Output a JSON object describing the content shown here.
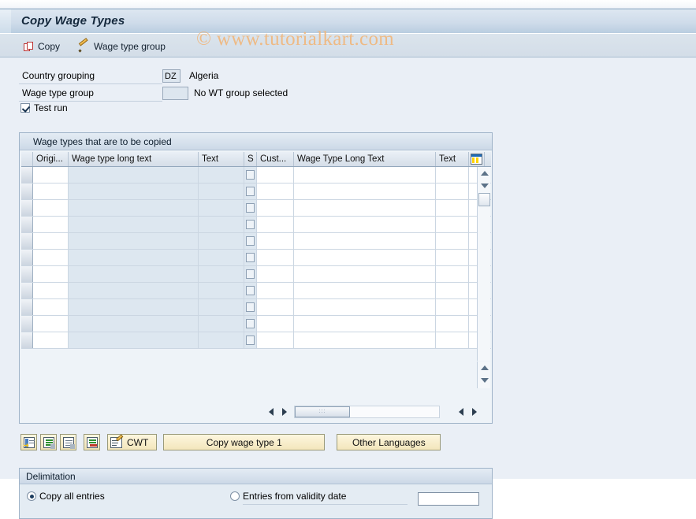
{
  "window": {
    "title": "Copy Wage Types"
  },
  "toolbar": {
    "copy_label": "Copy",
    "copy_icon": "copy-icon",
    "wage_type_group_label": "Wage type group",
    "wage_type_group_icon": "pencil-icon"
  },
  "watermark": {
    "text": "© www.tutorialkart.com"
  },
  "form": {
    "country_grouping": {
      "label": "Country grouping",
      "value": "DZ",
      "description": "Algeria"
    },
    "wage_type_group": {
      "label": "Wage type group",
      "value": "",
      "description": "No WT group selected"
    },
    "test_run": {
      "label": "Test run",
      "checked": true
    }
  },
  "table": {
    "title": "Wage types that are to be copied",
    "columns": [
      {
        "key": "selbar",
        "label": "",
        "width": 15,
        "type": "select"
      },
      {
        "key": "orig",
        "label": "Origi...",
        "width": 45,
        "type": "white"
      },
      {
        "key": "wtlong",
        "label": "Wage type long text",
        "width": 165,
        "type": "blue"
      },
      {
        "key": "text1",
        "label": "Text",
        "width": 58,
        "type": "blue"
      },
      {
        "key": "s",
        "label": "S",
        "width": 16,
        "type": "check"
      },
      {
        "key": "cust",
        "label": "Cust...",
        "width": 47,
        "type": "white"
      },
      {
        "key": "wtlong2",
        "label": "Wage Type Long Text",
        "width": 180,
        "type": "white"
      },
      {
        "key": "text2",
        "label": "Text",
        "width": 42,
        "type": "white"
      },
      {
        "key": "config",
        "label": "",
        "width": 20,
        "type": "config",
        "icon": "column-config-icon"
      }
    ],
    "rows": [
      {},
      {},
      {},
      {},
      {},
      {},
      {},
      {},
      {},
      {},
      {}
    ],
    "scroll": {
      "up_icon": "scroll-up-icon",
      "down_icon": "scroll-down-icon",
      "left_icon": "scroll-left-icon",
      "right_icon": "scroll-right-icon"
    }
  },
  "actions": {
    "icon_buttons": [
      {
        "name": "insert-entry-button",
        "icon": "insert-row-icon"
      },
      {
        "name": "copy-entry-button",
        "icon": "copy-row-icon"
      },
      {
        "name": "duplicate-entry-button",
        "icon": "duplicate-row-icon"
      },
      {
        "name": "delete-entry-button",
        "icon": "delete-row-icon"
      }
    ],
    "cwt_label": "CWT",
    "cwt_icon": "edit-document-icon",
    "copy_wage_type_label": "Copy wage type 1",
    "other_languages_label": "Other Languages"
  },
  "delimitation": {
    "title": "Delimitation",
    "copy_all": {
      "label": "Copy all entries",
      "selected": true
    },
    "from_date": {
      "label": "Entries from validity date",
      "selected": false,
      "value": "",
      "placeholder": ""
    }
  }
}
